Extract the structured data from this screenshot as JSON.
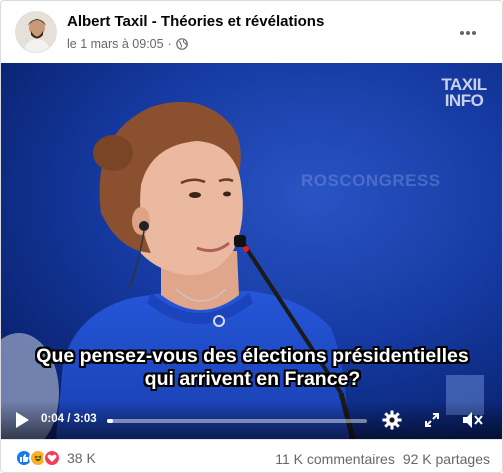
{
  "post": {
    "author": "Albert Taxil - Théories et révélations",
    "date": "le 1 mars à 09:05",
    "separator": "·",
    "privacy_icon": "globe-icon",
    "more_icon": "more-options-icon"
  },
  "video": {
    "watermark_line1": "TAXIL",
    "watermark_line2": "INFO",
    "background_logo": "ROSCONGRESS",
    "caption_line1": "Que pensez-vous des élections présidentielles",
    "caption_line2": "qui arrivent en France?",
    "time": "0:04 / 3:03",
    "progress_fraction": 0.022,
    "colors": {
      "background": "#0e2f96",
      "dress": "#1d49c8",
      "skin": "#e9b59c",
      "hair": "#8a5030"
    }
  },
  "footer": {
    "reaction_icons": [
      "like-icon",
      "haha-icon",
      "love-icon"
    ],
    "reaction_count": "38 K",
    "comments": "11 K commentaires",
    "shares": "92 K partages",
    "colors": {
      "like": "#1877f2",
      "haha": "#f7b125",
      "love": "#f33e58"
    }
  }
}
